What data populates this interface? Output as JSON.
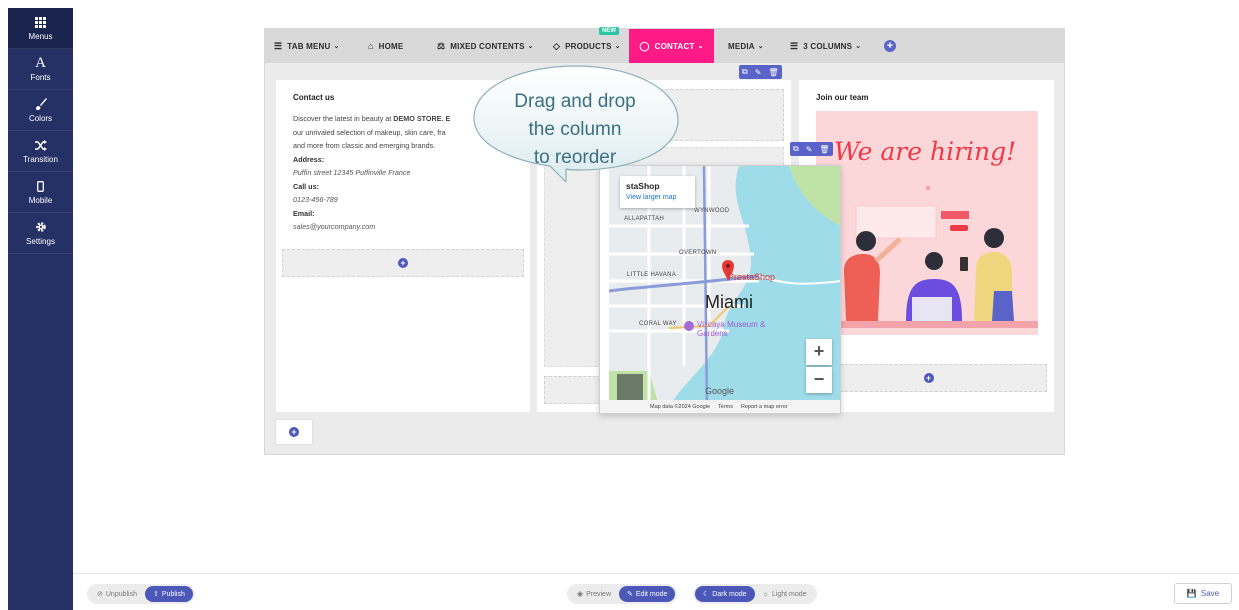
{
  "sidebar": {
    "items": [
      {
        "label": "Menus",
        "icon": "grid-icon"
      },
      {
        "label": "Fonts",
        "icon": "font-icon",
        "glyph": "A"
      },
      {
        "label": "Colors",
        "icon": "brush-icon"
      },
      {
        "label": "Transition",
        "icon": "shuffle-icon"
      },
      {
        "label": "Mobile",
        "icon": "mobile-icon"
      },
      {
        "label": "Settings",
        "icon": "gear-icon"
      }
    ]
  },
  "menu": {
    "tab_menu": "TAB MENU",
    "home": "HOME",
    "mixed_contents": "MIXED CONTENTS",
    "products": "PRODUCTS",
    "new_badge": "NEW",
    "contact": "CONTACT",
    "media": "MEDIA",
    "three_columns": "3 COLUMNS"
  },
  "contact_column": {
    "title": "Contact us",
    "intro_1": "Discover the latest in beauty at ",
    "intro_store": "DEMO STORE. E",
    "intro_2": "our unrivaled selection of makeup, skin care, fra",
    "intro_3": "and more from classic and emerging brands.",
    "address_label": "Address:",
    "address": "Puffin street 12345 Puffinville France",
    "call_label": "Call us:",
    "phone": "0123-456-789",
    "email_label": "Email:",
    "email": "sales@yourcompany.com"
  },
  "team_column": {
    "title": "Join our team",
    "hiring_text": "We are hiring!"
  },
  "map": {
    "place": "PrestaShop",
    "place_card": "staShop",
    "view_larger": "View larger map",
    "city": "Miami",
    "museum": "Vizcaya Museum & Gardens",
    "labels": [
      "ALLAPATTAH",
      "OVERTOWN",
      "LITTLE HAVANA",
      "CORAL WAY",
      "WYNWOOD"
    ],
    "attribution": "Map data ©2024 Google",
    "terms": "Terms",
    "report": "Report a map error",
    "google": "Google"
  },
  "tooltip": {
    "line1": "Drag and drop",
    "line2": "the column",
    "line3": "to reorder"
  },
  "bottom": {
    "unpublish": "Unpublish",
    "publish": "Publish",
    "preview": "Preview",
    "edit_mode": "Edit mode",
    "dark_mode": "Dark mode",
    "light_mode": "Light mode",
    "save": "Save"
  },
  "colors": {
    "sidebar": "#253064",
    "accent": "#5a63c8",
    "contact_tab": "#ff1b86",
    "new_badge": "#2bc5a2"
  }
}
